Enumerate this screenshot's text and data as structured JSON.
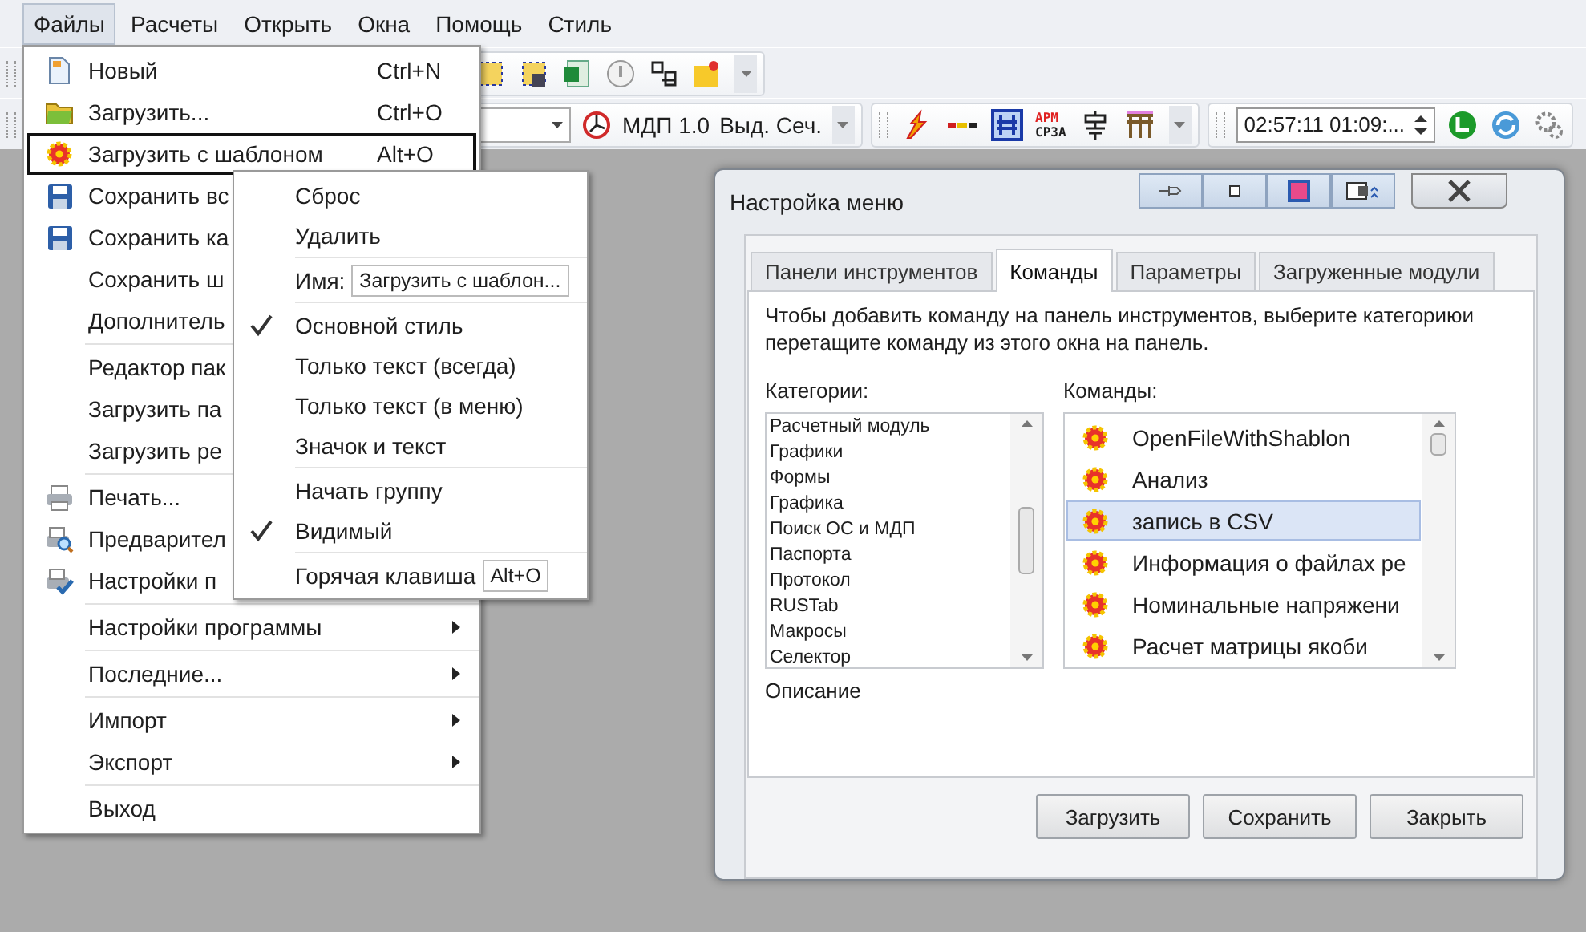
{
  "menubar": [
    {
      "label": "Файлы",
      "selected": true
    },
    {
      "label": "Расчеты",
      "selected": false
    },
    {
      "label": "Открыть",
      "selected": false
    },
    {
      "label": "Окна",
      "selected": false
    },
    {
      "label": "Помощь",
      "selected": false
    },
    {
      "label": "Стиль",
      "selected": false
    }
  ],
  "toolbar_2": {
    "labels": [
      "МДП 1.0",
      "Выд. Сеч."
    ],
    "arm_icon": [
      "АРМ",
      "СРЗА"
    ],
    "time_field": "02:57:11  01:09:..."
  },
  "file_menu": [
    {
      "kind": "item",
      "label": "Новый",
      "shortcut": "Ctrl+N",
      "selected": false
    },
    {
      "kind": "item",
      "label": "Загрузить...",
      "shortcut": "Ctrl+O",
      "selected": false
    },
    {
      "kind": "item",
      "label": "Загрузить с шаблоном",
      "shortcut": "Alt+O",
      "selected": true
    },
    {
      "kind": "item",
      "label": "Сохранить вс",
      "selected": false
    },
    {
      "kind": "item",
      "label": "Сохранить ка",
      "selected": false
    },
    {
      "kind": "item",
      "label": "Сохранить ш",
      "selected": false
    },
    {
      "kind": "item",
      "label": "Дополнитель",
      "selected": false
    },
    {
      "kind": "separator"
    },
    {
      "kind": "item",
      "label": "Редактор пак",
      "selected": false
    },
    {
      "kind": "item",
      "label": "Загрузить па",
      "selected": false
    },
    {
      "kind": "item",
      "label": "Загрузить ре",
      "selected": false
    },
    {
      "kind": "separator"
    },
    {
      "kind": "item",
      "label": "Печать...",
      "selected": false
    },
    {
      "kind": "item",
      "label": "Предварител",
      "selected": false
    },
    {
      "kind": "item",
      "label": "Настройки п",
      "selected": false
    },
    {
      "kind": "separator"
    },
    {
      "kind": "item",
      "label": "Настройки программы",
      "submenu": true,
      "selected": false
    },
    {
      "kind": "separator"
    },
    {
      "kind": "item",
      "label": "Последние...",
      "submenu": true,
      "selected": false
    },
    {
      "kind": "separator"
    },
    {
      "kind": "item",
      "label": "Импорт",
      "submenu": true,
      "selected": false
    },
    {
      "kind": "item",
      "label": "Экспорт",
      "submenu": true,
      "selected": false
    },
    {
      "kind": "separator"
    },
    {
      "kind": "item",
      "label": "Выход",
      "selected": false
    }
  ],
  "context_menu": [
    {
      "kind": "item",
      "label": "Сброс"
    },
    {
      "kind": "item",
      "label": "Удалить"
    },
    {
      "kind": "separator"
    },
    {
      "kind": "field",
      "label": "Имя:",
      "value": "Загрузить с шаблон..."
    },
    {
      "kind": "separator"
    },
    {
      "kind": "check",
      "label": "Основной стиль",
      "checked": true
    },
    {
      "kind": "check",
      "label": "Только текст (всегда)",
      "checked": false
    },
    {
      "kind": "check",
      "label": "Только текст (в меню)",
      "checked": false
    },
    {
      "kind": "check",
      "label": "Значок и текст",
      "checked": false
    },
    {
      "kind": "separator"
    },
    {
      "kind": "check",
      "label": "Начать группу",
      "checked": false
    },
    {
      "kind": "check",
      "label": "Видимый",
      "checked": true
    },
    {
      "kind": "separator"
    },
    {
      "kind": "field",
      "label": "Горячая клавиша",
      "value": "Alt+O"
    }
  ],
  "dialog": {
    "title": "Настройка меню",
    "tabs": [
      {
        "label": "Панели инструментов",
        "selected": false
      },
      {
        "label": "Команды",
        "selected": true
      },
      {
        "label": "Параметры",
        "selected": false
      },
      {
        "label": "Загруженные модули",
        "selected": false
      }
    ],
    "hint": "Чтобы добавить команду на панель инструментов, выберите категориюи перетащите команду из этого окна на панель.",
    "categories_label": "Категории:",
    "categories": [
      "Расчетный модуль",
      "Графики",
      "Формы",
      "Графика",
      "Поиск ОС и МДП",
      "Паспорта",
      "Протокол",
      "RUSTab",
      "Макросы",
      "Селектор"
    ],
    "commands_label": "Команды:",
    "commands": [
      {
        "label": "OpenFileWithShablon",
        "selected": false
      },
      {
        "label": "Анализ",
        "selected": false
      },
      {
        "label": "запись в CSV",
        "selected": true
      },
      {
        "label": "Информация о файлах ре",
        "selected": false
      },
      {
        "label": "Номинальные напряжени",
        "selected": false
      },
      {
        "label": "Расчет матрицы якоби",
        "selected": false
      }
    ],
    "description_label": "Описание",
    "buttons": [
      "Загрузить",
      "Сохранить",
      "Закрыть"
    ]
  }
}
